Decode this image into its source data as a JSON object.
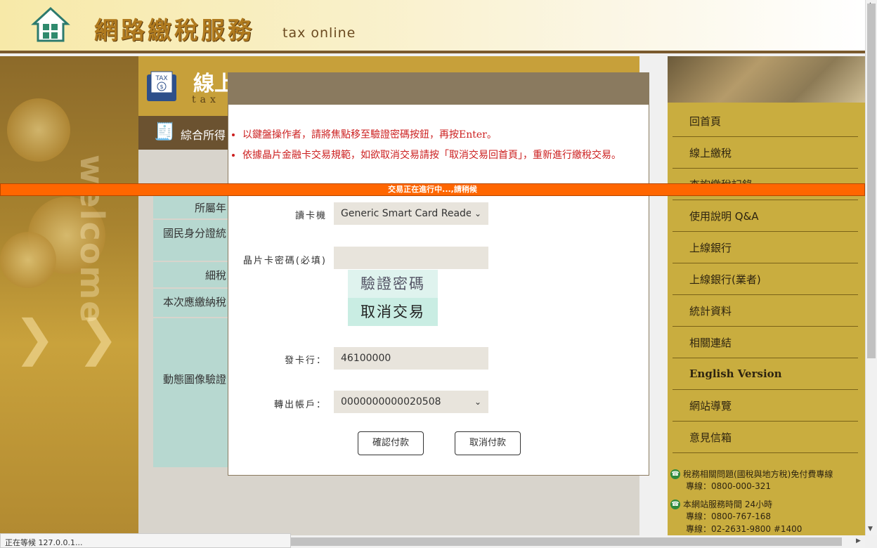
{
  "header": {
    "title": "網路繳稅服務",
    "subtitle": "tax online"
  },
  "left_deco": {
    "welcome": "welcome"
  },
  "main": {
    "heading": "線上",
    "heading_sub": "tax o",
    "tab_label": "綜合所得",
    "form_labels": [
      "所屬年",
      "國民身分證統",
      "細稅",
      "本次應繳納稅"
    ],
    "captcha_label": "動態圖像驗證"
  },
  "modal": {
    "notices": [
      "以鍵盤操作者，請將焦點移至驗證密碼按鈕，再按Enter。",
      "依據晶片金融卡交易規範，如欲取消交易請按「取消交易回首頁」，重新進行繳稅交易。"
    ],
    "card_reader_label": "讀卡機",
    "card_reader_value": "Generic Smart Card Reade",
    "pin_label": "晶片卡密碼(必填)",
    "pin_value": "",
    "verify_label": "驗證密碼",
    "cancel_tx_label": "取消交易",
    "issuer_label": "發卡行：",
    "issuer_value": "46100000",
    "account_label": "轉出帳戶：",
    "account_value": "0000000000020508",
    "confirm_label": "確認付款",
    "cancel_pay_label": "取消付款"
  },
  "progress": {
    "text": "交易正在進行中...,請稍候"
  },
  "sidebar": {
    "items": [
      {
        "label": "回首頁"
      },
      {
        "label": "線上繳稅"
      },
      {
        "label": "查詢繳稅記錄"
      },
      {
        "label": "使用說明 Q&A"
      },
      {
        "label": "上線銀行"
      },
      {
        "label": "上線銀行(業者)"
      },
      {
        "label": "統計資料"
      },
      {
        "label": "相關連結"
      },
      {
        "label": "English Version"
      },
      {
        "label": "網站導覽"
      },
      {
        "label": "意見信箱"
      }
    ],
    "contacts": [
      {
        "title": "稅務相關問題(國稅與地方稅)免付費專線",
        "lines": [
          "專線：0800-000-321"
        ]
      },
      {
        "title": "本網站服務時間 24小時",
        "lines": [
          "專線：0800-767-168",
          "專線：02-2631-9800 #1400"
        ]
      }
    ]
  },
  "status_bar": {
    "text": "正在等候 127.0.0.1..."
  },
  "colors": {
    "progress": "#ff6600",
    "notice_text": "#cc1f1f",
    "modal_header": "#8a7a5f",
    "sidebar_bg": "#c9ad3f"
  }
}
